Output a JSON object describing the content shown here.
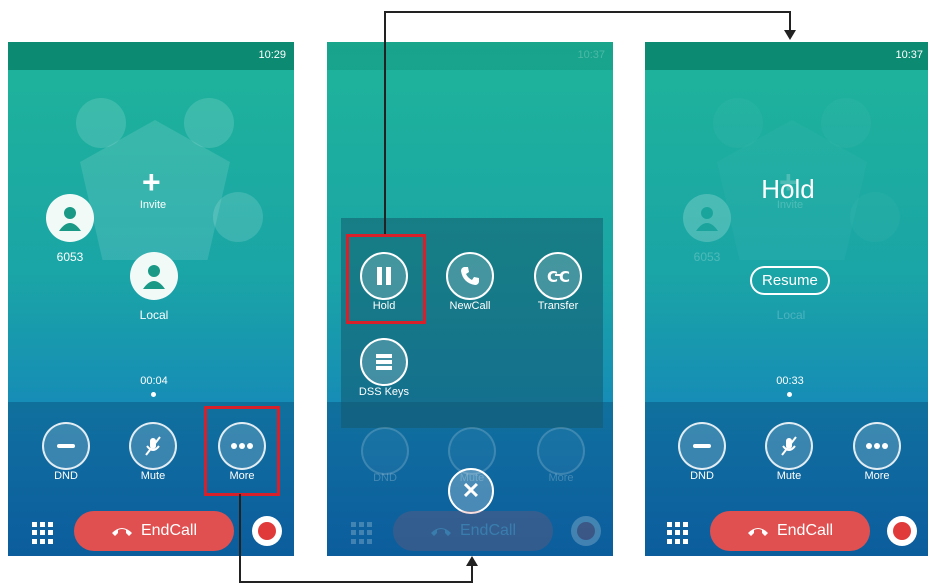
{
  "screens": [
    {
      "time": "10:29",
      "conference": {
        "invite_label": "Invite",
        "participant_name": "6053",
        "local_label": "Local"
      },
      "duration": "00:04",
      "controls": [
        {
          "label": "DND"
        },
        {
          "label": "Mute"
        },
        {
          "label": "More"
        }
      ],
      "end_call_label": "EndCall"
    },
    {
      "time": "10:37",
      "menu": [
        {
          "label": "Hold",
          "icon": "pause-icon"
        },
        {
          "label": "NewCall",
          "icon": "phone-icon"
        },
        {
          "label": "Transfer",
          "icon": "transfer-icon"
        },
        {
          "label": "DSS Keys",
          "icon": "list-icon"
        }
      ],
      "dim_controls": [
        {
          "label": "DND"
        },
        {
          "label": "Mute"
        },
        {
          "label": "More"
        }
      ],
      "end_call_label": "EndCall"
    },
    {
      "time": "10:37",
      "hold_title": "Hold",
      "resume_label": "Resume",
      "conference": {
        "invite_label": "Invite",
        "participant_name": "6053",
        "local_label": "Local"
      },
      "duration": "00:33",
      "controls": [
        {
          "label": "DND"
        },
        {
          "label": "Mute"
        },
        {
          "label": "More"
        }
      ],
      "end_call_label": "EndCall"
    }
  ],
  "colors": {
    "highlight": "#d8202a",
    "end_call": "#e15050",
    "status_bar": "#0c8a72"
  }
}
